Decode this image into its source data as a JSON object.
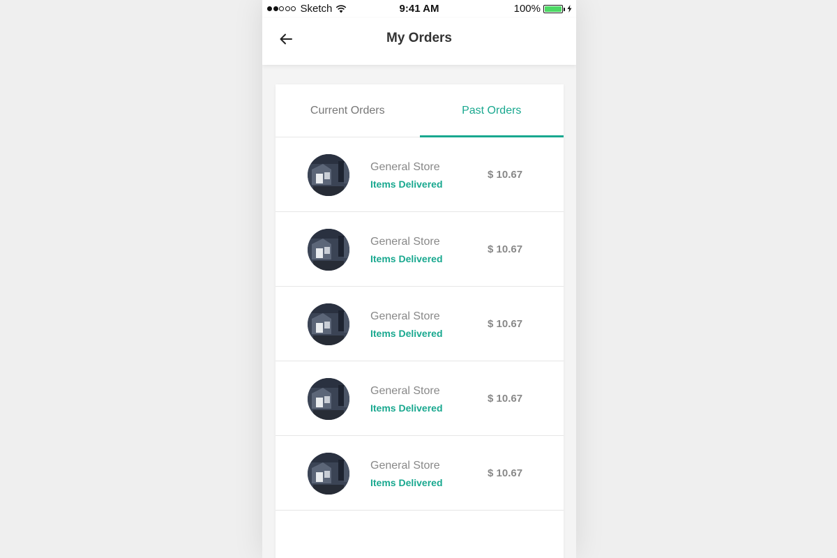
{
  "status_bar": {
    "carrier": "Sketch",
    "time": "9:41 AM",
    "battery": "100%",
    "signal_dots_filled": 2,
    "signal_dots_total": 5
  },
  "header": {
    "title": "My Orders",
    "back_icon": "arrow-left-icon"
  },
  "tabs": [
    {
      "label": "Current Orders",
      "active": false
    },
    {
      "label": "Past Orders",
      "active": true
    }
  ],
  "orders": [
    {
      "store": "General Store",
      "status": "Items Delivered",
      "price": "$ 10.67"
    },
    {
      "store": "General Store",
      "status": "Items Delivered",
      "price": "$ 10.67"
    },
    {
      "store": "General Store",
      "status": "Items Delivered",
      "price": "$ 10.67"
    },
    {
      "store": "General Store",
      "status": "Items Delivered",
      "price": "$ 10.67"
    },
    {
      "store": "General Store",
      "status": "Items Delivered",
      "price": "$ 10.67"
    }
  ],
  "colors": {
    "accent": "#19a88f",
    "background": "#efefef",
    "battery": "#4cd964"
  }
}
